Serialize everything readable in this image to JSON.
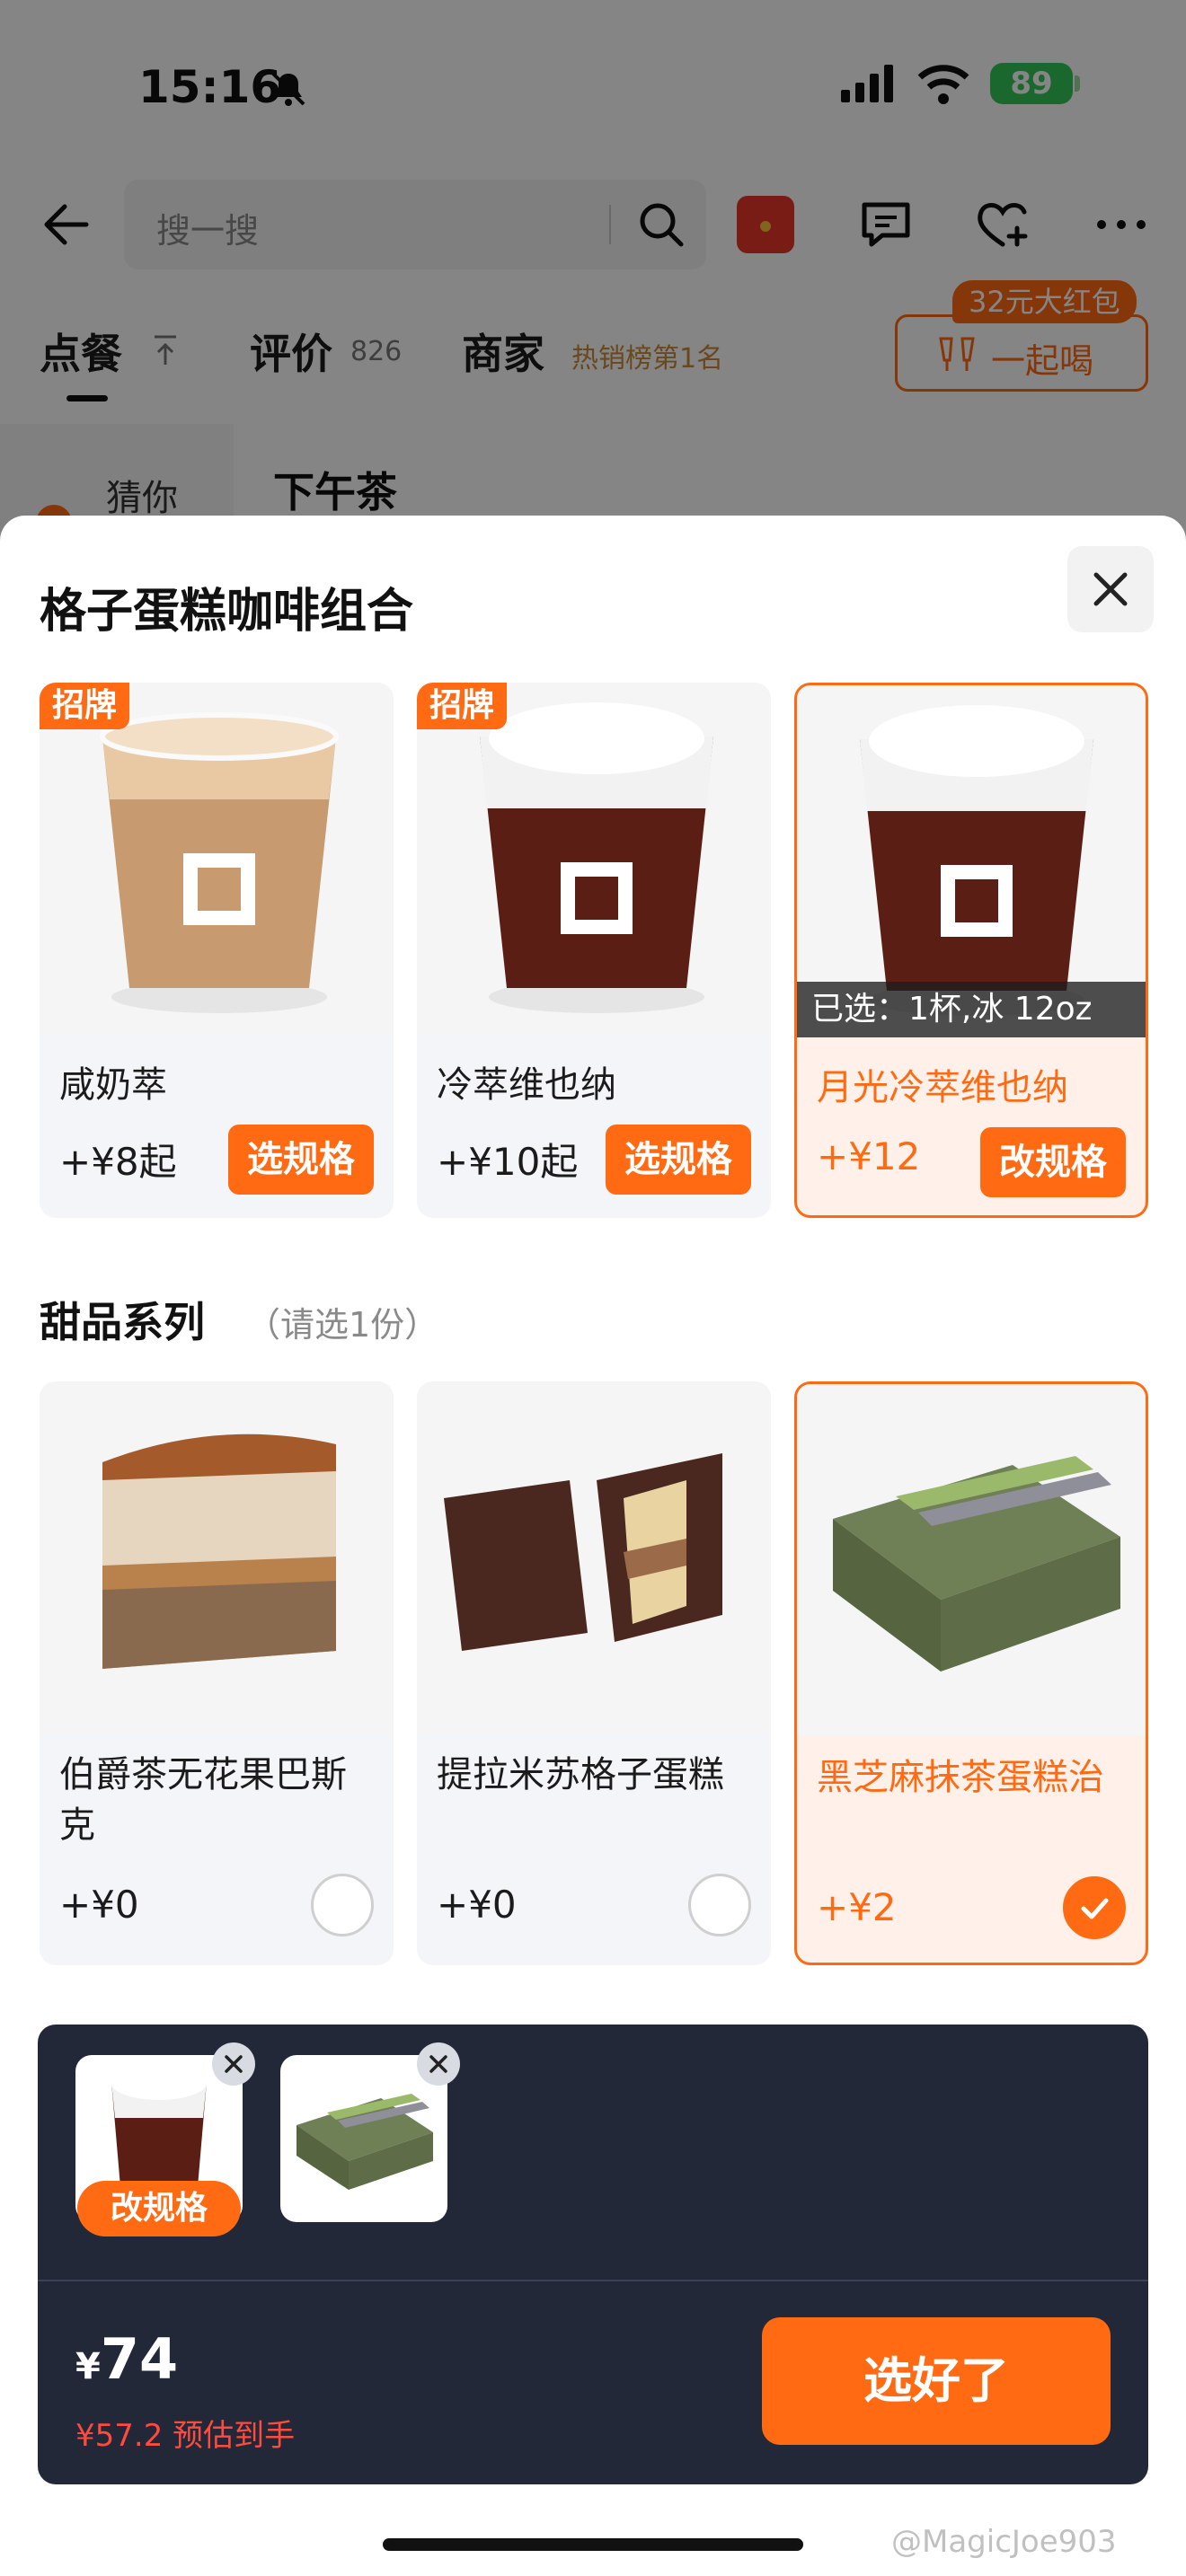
{
  "status": {
    "time": "15:16",
    "battery": "89"
  },
  "nav": {
    "search_placeholder": "搜一搜"
  },
  "tabs": {
    "order": "点餐",
    "reviews": "评价",
    "review_count": "826",
    "merchant": "商家",
    "merchant_badge": "热销榜第1名",
    "together_label": "一起喝",
    "together_badge": "32元大红包"
  },
  "sidebar": {
    "first_item": "猜你"
  },
  "section": {
    "title": "下午茶"
  },
  "sheet": {
    "title": "格子蛋糕咖啡组合",
    "drinks": [
      {
        "tag": "招牌",
        "name": "咸奶萃",
        "price": "+¥8起",
        "button": "选规格",
        "selected": false
      },
      {
        "tag": "招牌",
        "name": "冷萃维也纳",
        "price": "+¥10起",
        "button": "选规格",
        "selected": false
      },
      {
        "tag": "",
        "name": "月光冷萃维也纳",
        "price": "+¥12",
        "button": "改规格",
        "selected": true,
        "selected_spec": "已选：1杯,冰 12oz"
      }
    ],
    "dessert_section": {
      "title": "甜品系列",
      "hint": "（请选1份）"
    },
    "desserts": [
      {
        "name": "伯爵茶无花果巴斯克",
        "price": "+¥0",
        "selected": false
      },
      {
        "name": "提拉米苏格子蛋糕",
        "price": "+¥0",
        "selected": false
      },
      {
        "name": "黑芝麻抹茶蛋糕治",
        "price": "+¥2",
        "selected": true
      }
    ]
  },
  "cart": {
    "change_label": "改规格",
    "currency": "¥",
    "total": "74",
    "estimate_price": "¥57.2",
    "estimate_label": "预估到手",
    "confirm": "选好了"
  },
  "watermark": "@MagicJoe903",
  "colors": {
    "accent": "#ff6a13",
    "dark_bar": "#222838",
    "estimate": "#ff4a3d"
  }
}
